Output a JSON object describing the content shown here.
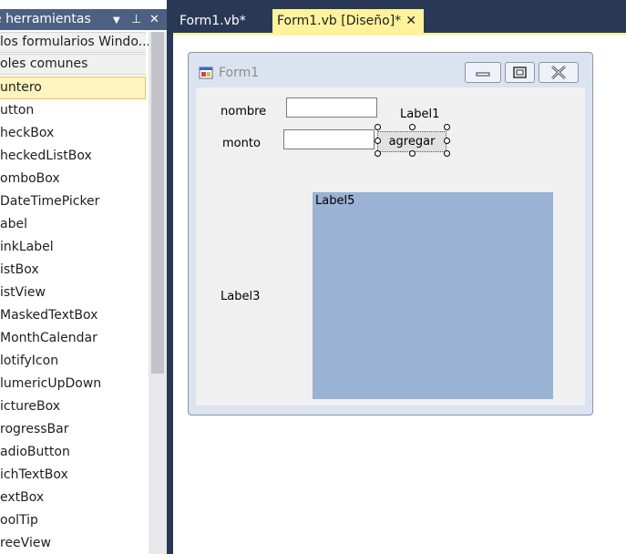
{
  "toolbox": {
    "title": "e herramientas",
    "groups": [
      "los formularios Windo...",
      "oles comunes"
    ],
    "items": [
      "untero",
      "utton",
      "heckBox",
      "heckedListBox",
      "omboBox",
      "DateTimePicker",
      "abel",
      "inkLabel",
      "istBox",
      "istView",
      "MaskedTextBox",
      "MonthCalendar",
      "lotifyIcon",
      "lumericUpDown",
      "ictureBox",
      "rogressBar",
      "adioButton",
      "ichTextBox",
      "extBox",
      "oolTip",
      "reeView"
    ],
    "dropdown_glyph": "▼",
    "pin_glyph": "⊥",
    "close_glyph": "✕"
  },
  "tabs": [
    {
      "label": "Form1.vb*"
    },
    {
      "label": "Form1.vb [Diseño]*",
      "close": "✕"
    }
  ],
  "form": {
    "title": "Form1",
    "labels": {
      "nombre": "nombre",
      "monto": "monto",
      "label1": "Label1",
      "label3": "Label3",
      "label5": "Label5"
    },
    "button": "agregar"
  },
  "colors": {
    "toolbox_title_bg": "#4d6082",
    "tab_active_bg": "#fff29d",
    "selected_item_bg": "#fdf4bf",
    "label5_bg": "#9ab2d3",
    "ide_background": "#293955"
  }
}
